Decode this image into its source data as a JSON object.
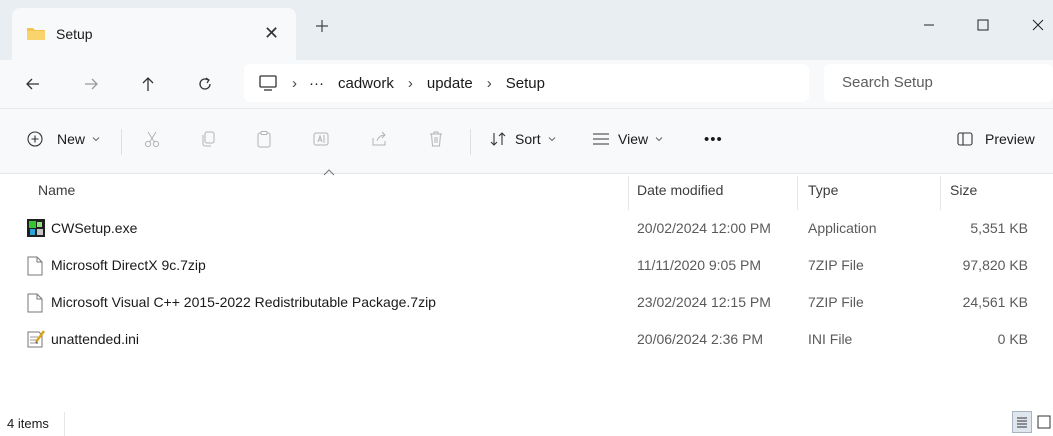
{
  "window": {
    "tab_title": "Setup",
    "tab_close": "✕",
    "new_tab": "+",
    "minimize": "—",
    "maximize": "☐",
    "close": "✕"
  },
  "nav": {
    "back_icon": "arrow-left-icon",
    "forward_icon": "arrow-right-icon",
    "up_icon": "arrow-up-icon",
    "refresh_icon": "refresh-icon"
  },
  "breadcrumb": {
    "more": "···",
    "items": [
      "cadwork",
      "update",
      "Setup"
    ],
    "separator": "›"
  },
  "search": {
    "placeholder": "Search Setup"
  },
  "toolbar": {
    "new_label": "New",
    "sort_label": "Sort",
    "view_label": "View",
    "more_label": "•••",
    "preview_label": "Preview"
  },
  "columns": {
    "name": "Name",
    "date": "Date modified",
    "type": "Type",
    "size": "Size"
  },
  "files": [
    {
      "name": "CWSetup.exe",
      "date": "20/02/2024 12:00 PM",
      "type": "Application",
      "size": "5,351 KB",
      "icon": "application-icon"
    },
    {
      "name": "Microsoft DirectX 9c.7zip",
      "date": "11/11/2020 9:05 PM",
      "type": "7ZIP File",
      "size": "97,820 KB",
      "icon": "file-icon"
    },
    {
      "name": "Microsoft Visual C++ 2015-2022 Redistributable Package.7zip",
      "date": "23/02/2024 12:15 PM",
      "type": "7ZIP File",
      "size": "24,561 KB",
      "icon": "file-icon"
    },
    {
      "name": "unattended.ini",
      "date": "20/06/2024 2:36 PM",
      "type": "INI File",
      "size": "0 KB",
      "icon": "settings-file-icon"
    }
  ],
  "status": {
    "item_count": "4 items"
  },
  "colors": {
    "accent": "#0067c0",
    "folder": "#f4c44e",
    "chrome": "#e9eef3"
  }
}
